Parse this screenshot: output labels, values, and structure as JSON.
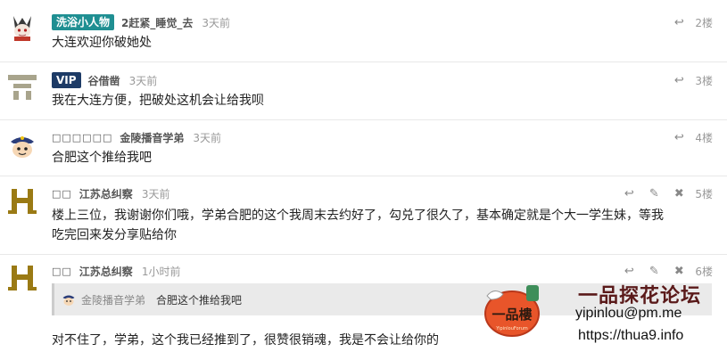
{
  "posts": [
    {
      "badge": "洗浴小人物",
      "username": "2赶紧_睡觉_去",
      "time": "3天前",
      "floor": "2楼",
      "content": "大连欢迎你破她处"
    },
    {
      "badge": "VIP",
      "username": "谷借凿",
      "time": "3天前",
      "floor": "3楼",
      "content": "我在大连方便，把破处这机会让给我呗"
    },
    {
      "badge": "□□□□□□",
      "username": "金陵播音学弟",
      "time": "3天前",
      "floor": "4楼",
      "content": "合肥这个推给我吧"
    },
    {
      "badge": "□□",
      "username": "江苏总纠察",
      "time": "3天前",
      "floor": "5楼",
      "content_line1": "楼上三位，我谢谢你们哦，学弟合肥的这个我周末去约好了，勾兑了很久了，基本确定就是个大一学生妹，等我",
      "content_line2": "吃完回来发分享贴给你"
    },
    {
      "badge": "□□",
      "username": "江苏总纠察",
      "time": "1小时前",
      "floor": "6楼",
      "quote_user": "金陵播音学弟",
      "quote_text": "合肥这个推给我吧",
      "content": "对不住了，学弟，这个我已经推到了，很赞很销魂，我是不会让给你的"
    }
  ],
  "watermark": {
    "logo_text": "一品樓",
    "logo_subtext": "YipinlouForum",
    "title": "一品探花论坛",
    "email": "yipinlou@pm.me",
    "url": "https://thua9.info"
  },
  "colors": {
    "teal_badge": "#1f8f92",
    "navy_badge": "#1d3b66",
    "watermark_title": "#5a1a1a"
  }
}
